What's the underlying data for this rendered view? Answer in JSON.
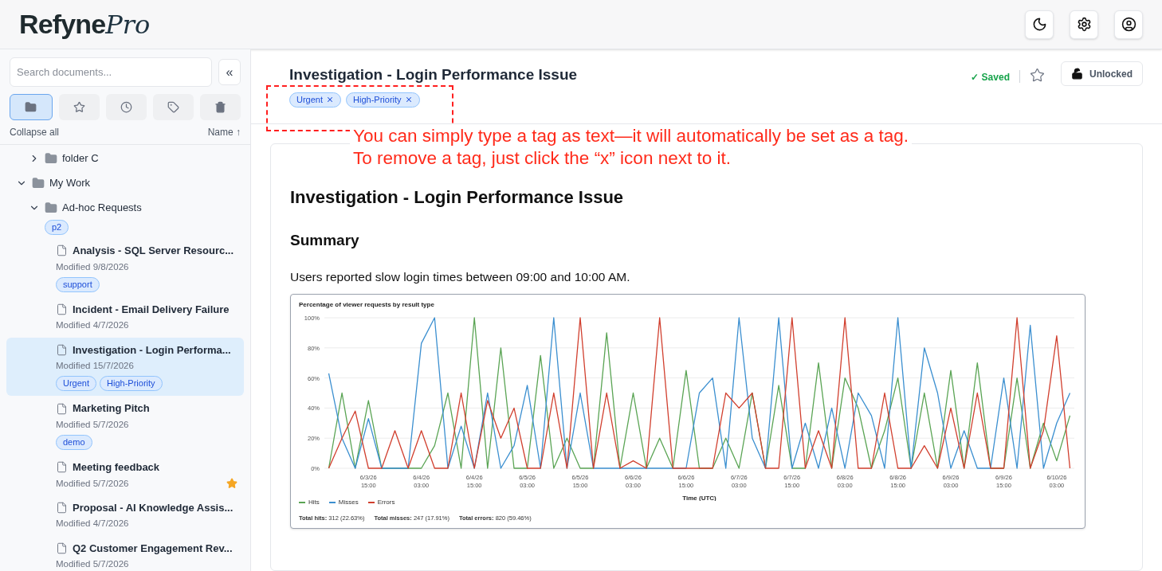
{
  "logo": {
    "primary": "Refyne",
    "accent": "Pro"
  },
  "header_buttons": [
    {
      "kind": "theme"
    },
    {
      "kind": "settings"
    },
    {
      "kind": "account"
    }
  ],
  "sidebar": {
    "search": {
      "placeholder": "Search documents..."
    },
    "collapse_button": "«",
    "view_buttons": [
      {
        "kind": "folders",
        "selected": true
      },
      {
        "kind": "favorites",
        "selected": false
      },
      {
        "kind": "recent",
        "selected": false
      },
      {
        "kind": "tags",
        "selected": false
      },
      {
        "kind": "trash",
        "selected": false
      }
    ],
    "collapse_all": "Collapse all",
    "sort": "Name ↑",
    "tree": [
      {
        "kind": "folder",
        "children": [
          {
            "kind": "folder",
            "name": "folder C",
            "expanded": false
          }
        ]
      },
      {
        "kind": "folder",
        "name": "My Work",
        "expanded": true,
        "children": [
          {
            "kind": "folder",
            "name": "Ad-hoc Requests",
            "expanded": true,
            "tags": [
              "p2"
            ],
            "children": [
              {
                "kind": "document",
                "name": "Analysis - SQL Server Resourc...",
                "modified": "Modified 9/8/2026",
                "tags": [
                  "support"
                ],
                "starred": false,
                "selected": false
              },
              {
                "kind": "document",
                "name": "Incident - Email Delivery Failure",
                "modified": "Modified 4/7/2026",
                "starred": false,
                "selected": false
              },
              {
                "kind": "document",
                "name": "Investigation - Login Performa...",
                "modified": "Modified 15/7/2026",
                "tags": [
                  "Urgent",
                  "High-Priority"
                ],
                "starred": false,
                "selected": true
              },
              {
                "kind": "document",
                "name": "Marketing Pitch",
                "modified": "Modified 5/7/2026",
                "tags": [
                  "demo"
                ],
                "starred": false,
                "selected": false
              },
              {
                "kind": "document",
                "name": "Meeting feedback",
                "modified": "Modified 5/7/2026",
                "starred": true,
                "selected": false
              },
              {
                "kind": "document",
                "name": "Proposal - AI Knowledge Assis...",
                "modified": "Modified 4/7/2026",
                "starred": false,
                "selected": false
              },
              {
                "kind": "document",
                "name": "Q2 Customer Engagement Rev...",
                "modified": "Modified 5/7/2026",
                "starred": false,
                "selected": false
              }
            ]
          }
        ]
      }
    ]
  },
  "editor": {
    "title": "Investigation - Login Performance Issue",
    "tags": [
      "Urgent",
      "High-Priority"
    ],
    "save_status": "✓ Saved",
    "starred": false,
    "lock": {
      "label": "Unlocked",
      "locked": false
    },
    "annotation": {
      "lines": [
        "You can simply type a tag as text—it will automatically be set as a tag.",
        "To remove a tag, just click the “x” icon next to it."
      ]
    },
    "document": {
      "heading": "Investigation - Login Performance Issue",
      "subheading": "Summary",
      "paragraph": "Users reported slow login times between 09:00 and 10:00 AM.",
      "chart": {
        "totals": [
          "**Total hits:** 312 (22.63%)",
          "**Total misses:** 247 (17.91%)",
          "**Total errors:** 820 (59.46%)"
        ],
        "chart_data": {
          "type": "line",
          "title": "Percentage of viewer requests by result type",
          "xlabel": "Time (UTC)",
          "categories": [
            null,
            null,
            null,
            "6/3/26 15:00",
            null,
            null,
            null,
            "6/4/26 03:00",
            null,
            null,
            null,
            "6/4/26 15:00",
            null,
            null,
            null,
            "6/5/26 03:00",
            null,
            null,
            null,
            "6/5/26 15:00",
            null,
            null,
            null,
            "6/6/26 03:00",
            null,
            null,
            null,
            "6/6/26 15:00",
            null,
            null,
            null,
            "6/7/26 03:00",
            null,
            null,
            null,
            "6/7/26 15:00",
            null,
            null,
            null,
            "6/8/26 03:00",
            null,
            null,
            null,
            "6/8/26 15:00",
            null,
            null,
            null,
            "6/9/26 03:00",
            null,
            null,
            null,
            "6/9/26 15:00",
            null,
            null,
            null,
            "6/10/26 03:00",
            null
          ],
          "ylim": [
            0,
            100
          ],
          "grid": true,
          "legend": true,
          "yticks": [
            {
              "value": 0,
              "label": "0%"
            },
            {
              "value": 20,
              "label": "20%"
            },
            {
              "value": 40,
              "label": "40%"
            },
            {
              "value": 60,
              "label": "60%"
            },
            {
              "value": 80,
              "label": "80%"
            },
            {
              "value": 100,
              "label": "100%"
            }
          ],
          "series": [
            {
              "name": "Hits",
              "color": "#5aa454",
              "values": [
                0,
                50,
                0,
                45,
                0,
                0,
                0,
                0,
                15,
                50,
                0,
                100,
                0,
                80,
                0,
                0,
                75,
                0,
                20,
                0,
                0,
                90,
                0,
                50,
                0,
                20,
                0,
                65,
                0,
                0,
                20,
                0,
                50,
                0,
                55,
                0,
                0,
                70,
                0,
                60,
                40,
                0,
                25,
                60,
                0,
                50,
                0,
                65,
                0,
                70,
                0,
                0,
                60,
                0,
                30,
                5,
                35
              ]
            },
            {
              "name": "Misses",
              "color": "#3b8fd0",
              "values": [
                63,
                20,
                0,
                33,
                0,
                0,
                0,
                83,
                100,
                0,
                28,
                0,
                50,
                0,
                15,
                55,
                0,
                100,
                0,
                50,
                0,
                0,
                0,
                0,
                0,
                0,
                0,
                0,
                50,
                60,
                0,
                100,
                20,
                0,
                100,
                0,
                30,
                0,
                40,
                0,
                50,
                35,
                0,
                100,
                0,
                80,
                50,
                0,
                25,
                0,
                0,
                60,
                0,
                95,
                0,
                30,
                50
              ]
            },
            {
              "name": "Errors",
              "color": "#d13f2e",
              "values": [
                0,
                20,
                38,
                0,
                0,
                25,
                0,
                25,
                0,
                0,
                50,
                0,
                45,
                20,
                40,
                0,
                0,
                50,
                0,
                100,
                0,
                50,
                0,
                5,
                0,
                100,
                0,
                0,
                0,
                0,
                50,
                40,
                50,
                0,
                0,
                100,
                0,
                25,
                0,
                100,
                0,
                0,
                50,
                0,
                0,
                15,
                0,
                40,
                0,
                50,
                0,
                0,
                100,
                0,
                25,
                88,
                0
              ]
            }
          ]
        }
      }
    }
  }
}
